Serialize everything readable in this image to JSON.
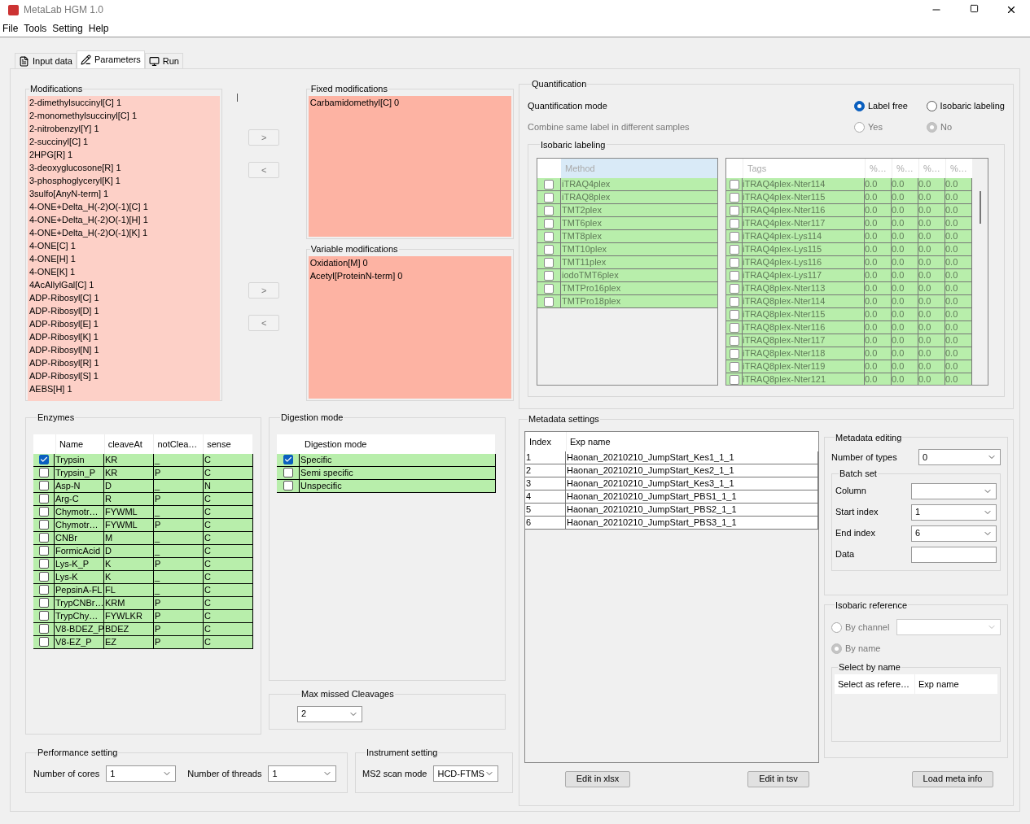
{
  "window": {
    "title": "MetaLab HGM 1.0"
  },
  "menu": [
    "File",
    "Tools",
    "Setting",
    "Help"
  ],
  "tabs": [
    {
      "label": "Input data",
      "selected": false
    },
    {
      "label": "Parameters",
      "selected": true
    },
    {
      "label": "Run",
      "selected": false
    }
  ],
  "modifications": {
    "title": "Modifications",
    "items": [
      "2-dimethylsuccinyl[C] 1",
      "2-monomethylsuccinyl[C] 1",
      "2-nitrobenzyl[Y] 1",
      "2-succinyl[C] 1",
      "2HPG[R] 1",
      "3-deoxyglucosone[R] 1",
      "3-phosphoglyceryl[K] 1",
      "3sulfo[AnyN-term] 1",
      "4-ONE+Delta_H(-2)O(-1)[C] 1",
      "4-ONE+Delta_H(-2)O(-1)[H] 1",
      "4-ONE+Delta_H(-2)O(-1)[K] 1",
      "4-ONE[C] 1",
      "4-ONE[H] 1",
      "4-ONE[K] 1",
      "4AcAllylGal[C] 1",
      "ADP-Ribosyl[C] 1",
      "ADP-Ribosyl[D] 1",
      "ADP-Ribosyl[E] 1",
      "ADP-Ribosyl[K] 1",
      "ADP-Ribosyl[N] 1",
      "ADP-Ribosyl[R] 1",
      "ADP-Ribosyl[S] 1",
      "AEBS[H] 1"
    ]
  },
  "fixed_buttons": [
    ">",
    "<"
  ],
  "fixed_modifications": {
    "title": "Fixed modifications",
    "items": [
      "Carbamidomethyl[C] 0"
    ]
  },
  "variable_buttons": [
    ">",
    "<"
  ],
  "variable_modifications": {
    "title": "Variable modifications",
    "items": [
      "Oxidation[M] 0",
      "Acetyl[ProteinN-term] 0"
    ]
  },
  "quantification": {
    "title": "Quantification",
    "mode_label": "Quantification mode",
    "modes": [
      {
        "label": "Label free",
        "selected": true
      },
      {
        "label": "Isobaric labeling",
        "selected": false
      }
    ],
    "combine_label": "Combine same label in different samples",
    "combine_disabled": true,
    "combine_options": [
      {
        "label": "Yes",
        "selected": false
      },
      {
        "label": "No",
        "selected": true
      }
    ],
    "isobaric": {
      "title": "Isobaric labeling",
      "disabled": true,
      "method_header": "Method",
      "methods": [
        {
          "name": "iTRAQ4plex",
          "checked": false
        },
        {
          "name": "iTRAQ8plex",
          "checked": false
        },
        {
          "name": "TMT2plex",
          "checked": false
        },
        {
          "name": "TMT6plex",
          "checked": false
        },
        {
          "name": "TMT8plex",
          "checked": false
        },
        {
          "name": "TMT10plex",
          "checked": false
        },
        {
          "name": "TMT11plex",
          "checked": false
        },
        {
          "name": "iodoTMT6plex",
          "checked": false
        },
        {
          "name": "TMTPro16plex",
          "checked": false
        },
        {
          "name": "TMTPro18plex",
          "checked": false
        }
      ],
      "tag_columns": [
        "Tags",
        "%…",
        "%…",
        "%…",
        "%…"
      ],
      "tags": [
        {
          "name": "iTRAQ4plex-Nter114",
          "checked": false,
          "values": [
            "0.0",
            "0.0",
            "0.0",
            "0.0"
          ]
        },
        {
          "name": "iTRAQ4plex-Nter115",
          "checked": false,
          "values": [
            "0.0",
            "0.0",
            "0.0",
            "0.0"
          ]
        },
        {
          "name": "iTRAQ4plex-Nter116",
          "checked": false,
          "values": [
            "0.0",
            "0.0",
            "0.0",
            "0.0"
          ]
        },
        {
          "name": "iTRAQ4plex-Nter117",
          "checked": false,
          "values": [
            "0.0",
            "0.0",
            "0.0",
            "0.0"
          ]
        },
        {
          "name": "iTRAQ4plex-Lys114",
          "checked": false,
          "values": [
            "0.0",
            "0.0",
            "0.0",
            "0.0"
          ]
        },
        {
          "name": "iTRAQ4plex-Lys115",
          "checked": false,
          "values": [
            "0.0",
            "0.0",
            "0.0",
            "0.0"
          ]
        },
        {
          "name": "iTRAQ4plex-Lys116",
          "checked": false,
          "values": [
            "0.0",
            "0.0",
            "0.0",
            "0.0"
          ]
        },
        {
          "name": "iTRAQ4plex-Lys117",
          "checked": false,
          "values": [
            "0.0",
            "0.0",
            "0.0",
            "0.0"
          ]
        },
        {
          "name": "iTRAQ8plex-Nter113",
          "checked": false,
          "values": [
            "0.0",
            "0.0",
            "0.0",
            "0.0"
          ]
        },
        {
          "name": "iTRAQ8plex-Nter114",
          "checked": false,
          "values": [
            "0.0",
            "0.0",
            "0.0",
            "0.0"
          ]
        },
        {
          "name": "iTRAQ8plex-Nter115",
          "checked": false,
          "values": [
            "0.0",
            "0.0",
            "0.0",
            "0.0"
          ]
        },
        {
          "name": "iTRAQ8plex-Nter116",
          "checked": false,
          "values": [
            "0.0",
            "0.0",
            "0.0",
            "0.0"
          ]
        },
        {
          "name": "iTRAQ8plex-Nter117",
          "checked": false,
          "values": [
            "0.0",
            "0.0",
            "0.0",
            "0.0"
          ]
        },
        {
          "name": "iTRAQ8plex-Nter118",
          "checked": false,
          "values": [
            "0.0",
            "0.0",
            "0.0",
            "0.0"
          ]
        },
        {
          "name": "iTRAQ8plex-Nter119",
          "checked": false,
          "values": [
            "0.0",
            "0.0",
            "0.0",
            "0.0"
          ]
        },
        {
          "name": "iTRAQ8plex-Nter121",
          "checked": false,
          "values": [
            "0.0",
            "0.0",
            "0.0",
            "0.0"
          ]
        }
      ]
    }
  },
  "enzymes": {
    "title": "Enzymes",
    "columns": [
      "Name",
      "cleaveAt",
      "notClea…",
      "sense"
    ],
    "rows": [
      {
        "checked": true,
        "cells": [
          "Trypsin",
          "KR",
          "_",
          "C"
        ]
      },
      {
        "checked": false,
        "cells": [
          "Trypsin_P",
          "KR",
          "P",
          "C"
        ]
      },
      {
        "checked": false,
        "cells": [
          "Asp-N",
          "D",
          "_",
          "N"
        ]
      },
      {
        "checked": false,
        "cells": [
          "Arg-C",
          "R",
          "P",
          "C"
        ]
      },
      {
        "checked": false,
        "cells": [
          "Chymotr…",
          "FYWML",
          "_",
          "C"
        ]
      },
      {
        "checked": false,
        "cells": [
          "Chymotr…",
          "FYWML",
          "P",
          "C"
        ]
      },
      {
        "checked": false,
        "cells": [
          "CNBr",
          "M",
          "_",
          "C"
        ]
      },
      {
        "checked": false,
        "cells": [
          "FormicAcid",
          "D",
          "_",
          "C"
        ]
      },
      {
        "checked": false,
        "cells": [
          "Lys-K_P",
          "K",
          "P",
          "C"
        ]
      },
      {
        "checked": false,
        "cells": [
          "Lys-K",
          "K",
          "_",
          "C"
        ]
      },
      {
        "checked": false,
        "cells": [
          "PepsinA-FL",
          "FL",
          "_",
          "C"
        ]
      },
      {
        "checked": false,
        "cells": [
          "TrypCNBr…",
          "KRM",
          "P",
          "C"
        ]
      },
      {
        "checked": false,
        "cells": [
          "TrypChy…",
          "FYWLKR",
          "P",
          "C"
        ]
      },
      {
        "checked": false,
        "cells": [
          "V8-BDEZ_P",
          "BDEZ",
          "P",
          "C"
        ]
      },
      {
        "checked": false,
        "cells": [
          "V8-EZ_P",
          "EZ",
          "P",
          "C"
        ]
      }
    ]
  },
  "digestion": {
    "title": "Digestion mode",
    "column": "Digestion mode",
    "rows": [
      {
        "label": "Specific",
        "checked": true
      },
      {
        "label": "Semi specific",
        "checked": false
      },
      {
        "label": "Unspecific",
        "checked": false
      }
    ]
  },
  "max_missed": {
    "title": "Max missed Cleavages",
    "value": "2"
  },
  "performance": {
    "title": "Performance setting",
    "cores_label": "Number of cores",
    "cores": "1",
    "threads_label": "Number of threads",
    "threads": "1"
  },
  "instrument": {
    "title": "Instrument setting",
    "label": "MS2 scan mode",
    "value": "HCD-FTMS"
  },
  "metadata": {
    "title": "Metadata settings",
    "columns": [
      "Index",
      "Exp name"
    ],
    "rows": [
      [
        "1",
        "Haonan_20210210_JumpStart_Kes1_1_1"
      ],
      [
        "2",
        "Haonan_20210210_JumpStart_Kes2_1_1"
      ],
      [
        "3",
        "Haonan_20210210_JumpStart_Kes3_1_1"
      ],
      [
        "4",
        "Haonan_20210210_JumpStart_PBS1_1_1"
      ],
      [
        "5",
        "Haonan_20210210_JumpStart_PBS2_1_1"
      ],
      [
        "6",
        "Haonan_20210210_JumpStart_PBS3_1_1"
      ]
    ],
    "buttons": [
      "Edit in xlsx",
      "Edit in tsv",
      "Load meta info"
    ]
  },
  "metadata_editing": {
    "title": "Metadata editing",
    "types_label": "Number of types",
    "types_value": "0",
    "batch_title": "Batch set",
    "fields": [
      {
        "label": "Column",
        "kind": "combo"
      },
      {
        "label": "Start index",
        "kind": "combo",
        "value": "1"
      },
      {
        "label": "End index",
        "kind": "combo",
        "value": "6"
      },
      {
        "label": "Data",
        "kind": "text"
      }
    ]
  },
  "isobaric_reference": {
    "title": "Isobaric reference",
    "disabled": true,
    "options": [
      {
        "label": "By channel",
        "selected": false
      },
      {
        "label": "By name",
        "selected": true
      }
    ],
    "select_title": "Select by name",
    "columns": [
      "Select as refere…",
      "Exp name"
    ]
  }
}
